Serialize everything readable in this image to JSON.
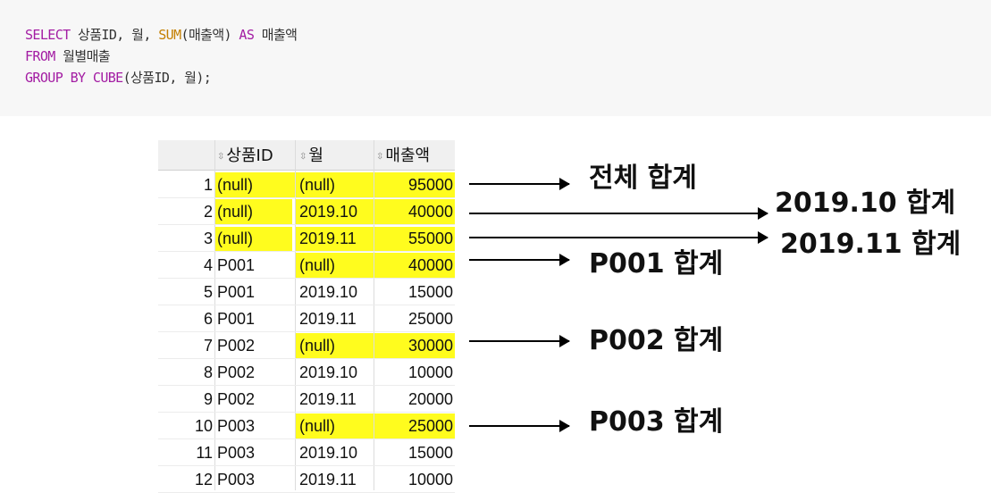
{
  "sql": {
    "line1": {
      "select": "SELECT",
      "cols": " 상품ID, 월, ",
      "sum": "SUM",
      "sum_arg": "(매출액) ",
      "as": "AS",
      "alias": " 매출액"
    },
    "line2": {
      "from": "FROM",
      "table": " 월별매출"
    },
    "line3": {
      "group": "GROUP BY",
      "sp": " ",
      "cube": "CUBE",
      "args": "(상품ID, 월);"
    }
  },
  "table": {
    "headers": [
      "상품ID",
      "월",
      "매출액"
    ],
    "rows": [
      {
        "n": "1",
        "pid": "(null)",
        "mon": "(null)",
        "amt": "95000"
      },
      {
        "n": "2",
        "pid": "(null)",
        "mon": "2019.10",
        "amt": "40000"
      },
      {
        "n": "3",
        "pid": "(null)",
        "mon": "2019.11",
        "amt": "55000"
      },
      {
        "n": "4",
        "pid": "P001",
        "mon": "(null)",
        "amt": "40000"
      },
      {
        "n": "5",
        "pid": "P001",
        "mon": "2019.10",
        "amt": "15000"
      },
      {
        "n": "6",
        "pid": "P001",
        "mon": "2019.11",
        "amt": "25000"
      },
      {
        "n": "7",
        "pid": "P002",
        "mon": "(null)",
        "amt": "30000"
      },
      {
        "n": "8",
        "pid": "P002",
        "mon": "2019.10",
        "amt": "10000"
      },
      {
        "n": "9",
        "pid": "P002",
        "mon": "2019.11",
        "amt": "20000"
      },
      {
        "n": "10",
        "pid": "P003",
        "mon": "(null)",
        "amt": "25000"
      },
      {
        "n": "11",
        "pid": "P003",
        "mon": "2019.10",
        "amt": "15000"
      },
      {
        "n": "12",
        "pid": "P003",
        "mon": "2019.11",
        "amt": "10000"
      }
    ]
  },
  "annotations": {
    "total": "전체 합계",
    "m1910": "2019.10 합계",
    "m1911": "2019.11 합계",
    "p001": "P001 합계",
    "p002": "P002 합계",
    "p003": "P003 합계"
  },
  "colors": {
    "highlight": "#fffc1e",
    "keyword": "#a31ca3",
    "function": "#c47f00"
  }
}
